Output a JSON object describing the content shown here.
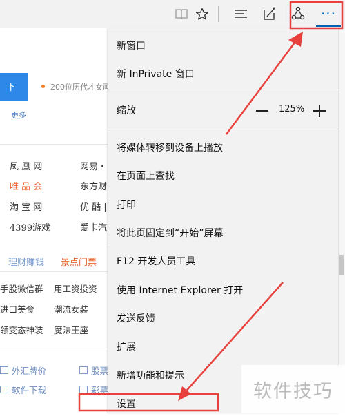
{
  "toolbar": {
    "icons": [
      "reading-view-icon",
      "favorites-star-icon",
      "hub-icon",
      "web-note-icon",
      "share-icon",
      "more-actions-icon"
    ],
    "more_label": "···",
    "accent_color": "#0063b1"
  },
  "page": {
    "button_label": "下",
    "news_text": "200位历代才女画",
    "more_link": "更多",
    "sites": [
      {
        "label": "凤 凰 网",
        "highlight": false
      },
      {
        "label": "网易・",
        "highlight": false
      },
      {
        "label": "唯 品 会",
        "highlight": true
      },
      {
        "label": "东方财",
        "highlight": false
      },
      {
        "label": "淘 宝 网",
        "highlight": false
      },
      {
        "label": "优 酷 |",
        "highlight": false
      },
      {
        "label": "4399游戏",
        "highlight": false
      },
      {
        "label": "爱卡汽",
        "highlight": false
      }
    ],
    "tabs": [
      {
        "label": "理财赚钱",
        "color": "#7a9ccc"
      },
      {
        "label": "景点门票",
        "color": "#e8622c"
      }
    ],
    "links": [
      "手股微信群",
      "用工资投资",
      "进口美食",
      "潮流女装",
      "领变态神装",
      "魔法王座"
    ],
    "services": [
      "外汇牌价",
      "股票",
      "软件下载",
      "彩票"
    ]
  },
  "menu": {
    "items": [
      {
        "label": "新窗口"
      },
      {
        "label": "新 InPrivate 窗口"
      },
      {
        "label": "缩放"
      },
      {
        "label": "将媒体转移到设备上播放"
      },
      {
        "label": "在页面上查找"
      },
      {
        "label": "打印"
      },
      {
        "label": "将此页固定到“开始”屏幕"
      },
      {
        "label": "F12 开发人员工具"
      },
      {
        "label": "使用 Internet Explorer 打开"
      },
      {
        "label": "发送反馈"
      },
      {
        "label": "扩展"
      },
      {
        "label": "新增功能和提示"
      },
      {
        "label": "设置"
      }
    ],
    "zoom_value": "125%"
  },
  "watermark": {
    "text": "软件技巧"
  },
  "annotation_color": "#e8403c"
}
